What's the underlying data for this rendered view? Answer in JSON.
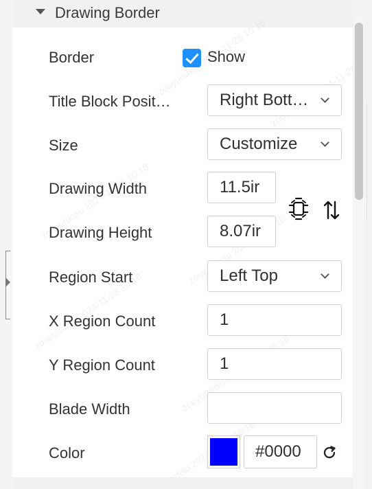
{
  "section": {
    "title": "Drawing Border"
  },
  "watermark": {
    "text": "zouyurunsu 2024-11-28 10:18"
  },
  "fields": {
    "border": {
      "label": "Border",
      "checkbox_label": "Show",
      "checked": true
    },
    "title_block_position": {
      "label": "Title Block Posit…",
      "value": "Right Bott…"
    },
    "size": {
      "label": "Size",
      "value": "Customize"
    },
    "drawing_width": {
      "label": "Drawing Width",
      "value": "11.5ir"
    },
    "drawing_height": {
      "label": "Drawing Height",
      "value": "8.07ir"
    },
    "region_start": {
      "label": "Region Start",
      "value": "Left Top"
    },
    "x_region_count": {
      "label": "X Region Count",
      "value": "1"
    },
    "y_region_count": {
      "label": "Y Region Count",
      "value": "1"
    },
    "blade_width": {
      "label": "Blade Width",
      "value": ""
    },
    "color": {
      "label": "Color",
      "value": "#0000",
      "swatch": "#0000ff"
    }
  },
  "icons": {
    "header_toggle": "collapse-arrow-icon",
    "checkbox": "checkmark-icon",
    "select": "chevron-down-icon",
    "aspect": "aspect-lock-icon",
    "swap": "swap-dimensions-icon",
    "reset": "reset-icon"
  },
  "colors": {
    "accent": "#1e90ff",
    "swatch": "#0000ff"
  }
}
